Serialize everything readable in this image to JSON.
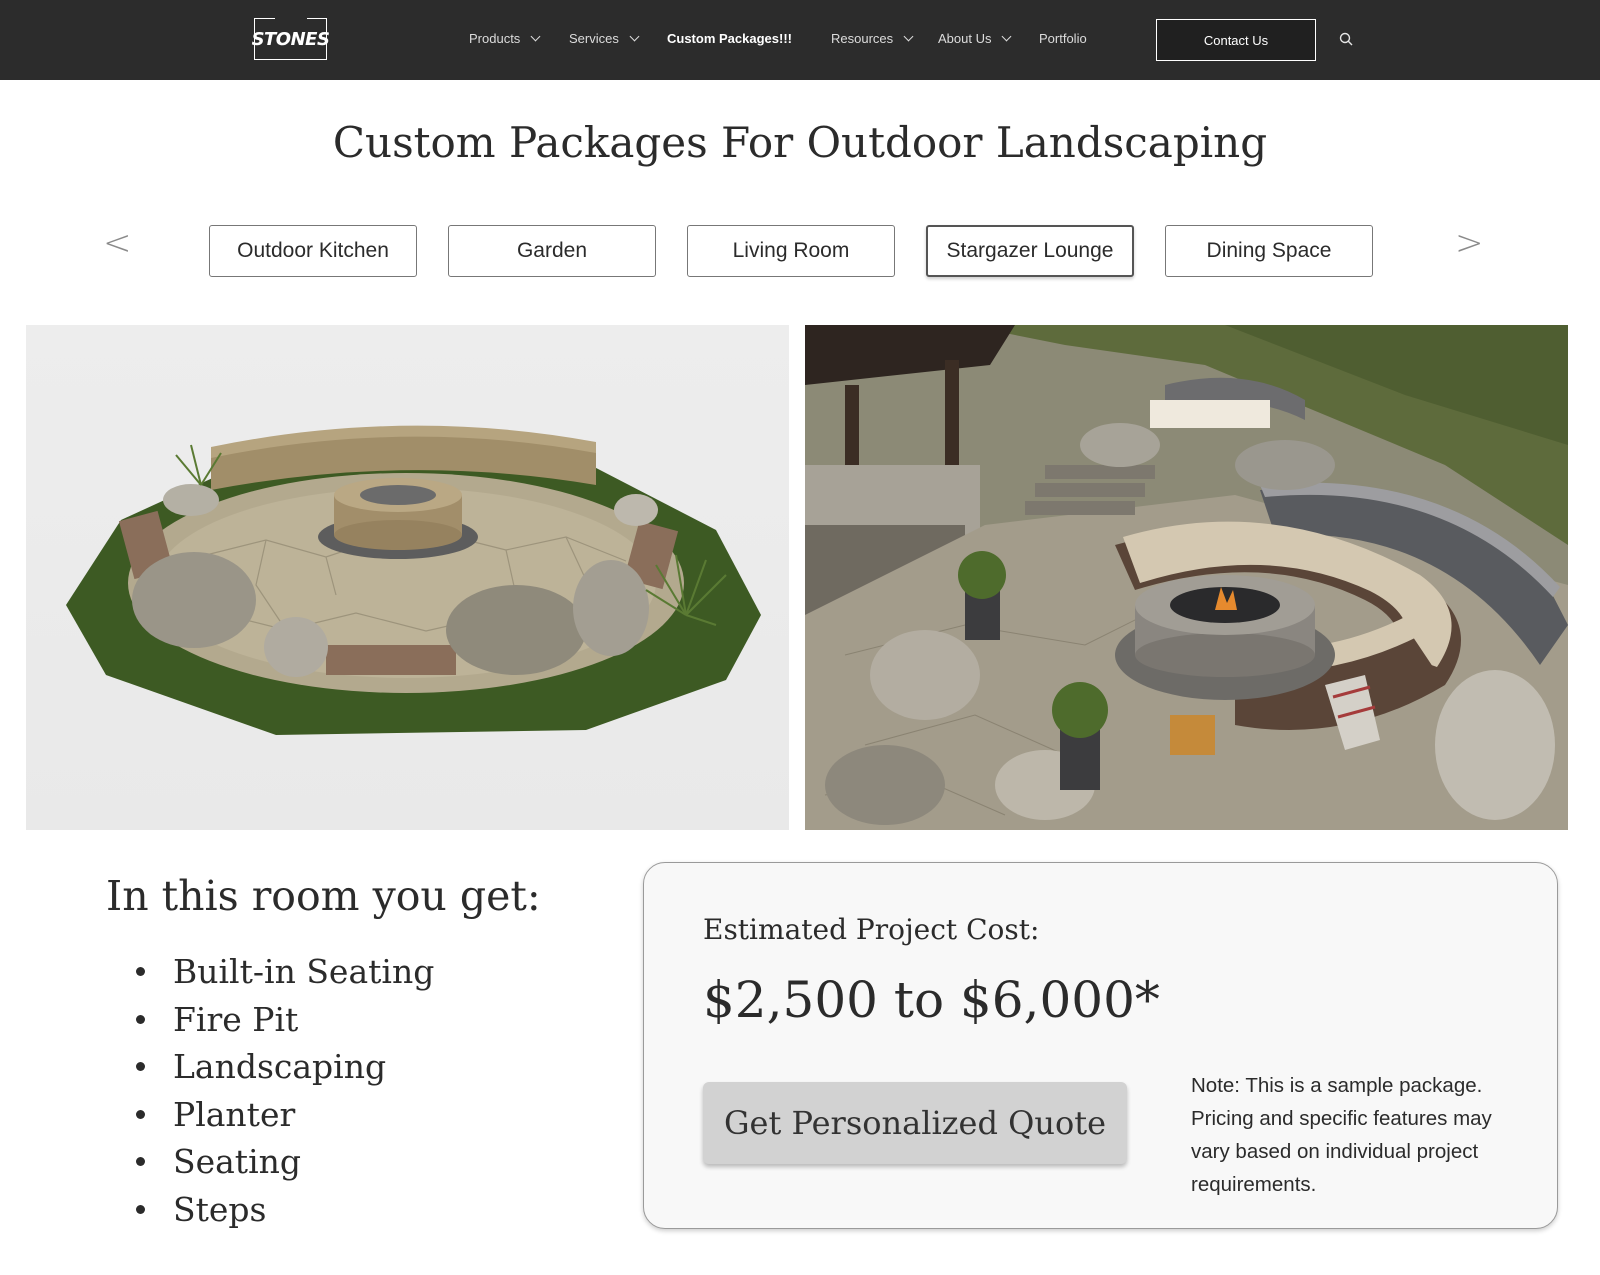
{
  "header": {
    "logo_text": "STONES",
    "nav": [
      {
        "label": "Products",
        "has_dropdown": true
      },
      {
        "label": "Services",
        "has_dropdown": true
      },
      {
        "label": "Custom Packages!!!",
        "has_dropdown": false,
        "active": true
      },
      {
        "label": "Resources",
        "has_dropdown": true
      },
      {
        "label": "About Us",
        "has_dropdown": true
      },
      {
        "label": "Portfolio",
        "has_dropdown": false
      }
    ],
    "contact_label": "Contact Us",
    "search_icon": "search-icon"
  },
  "page": {
    "title": "Custom Packages For Outdoor Landscaping"
  },
  "tabs": {
    "prev_arrow": "<",
    "next_arrow": ">",
    "items": [
      {
        "label": "Outdoor Kitchen"
      },
      {
        "label": "Garden"
      },
      {
        "label": "Living Room"
      },
      {
        "label": "Stargazer Lounge",
        "selected": true
      },
      {
        "label": "Dining Space"
      }
    ]
  },
  "features": {
    "heading": "In this room you get:",
    "items": [
      "Built-in Seating",
      "Fire Pit",
      "Landscaping",
      "Planter",
      "Seating",
      "Steps"
    ]
  },
  "cost": {
    "label": "Estimated Project Cost:",
    "value": "$2,500 to $6,000*",
    "quote_button": "Get Personalized Quote",
    "note": "Note: This is a sample package. Pricing and specific features may vary based on individual project requirements."
  },
  "colors": {
    "nav_background": "#2c2c2c",
    "card_background": "#f8f8f8",
    "quote_button": "#d2d2d2"
  }
}
